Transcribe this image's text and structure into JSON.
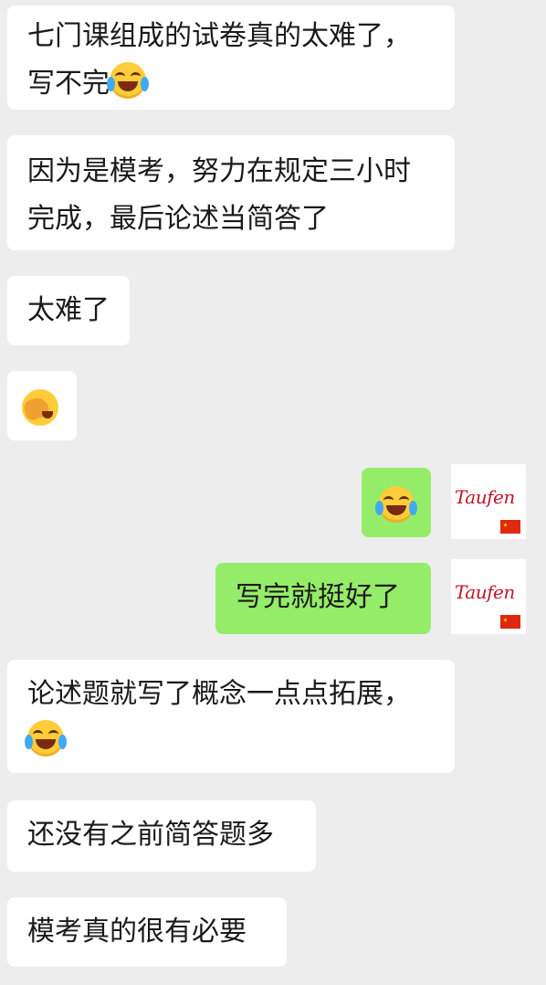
{
  "messages": {
    "m1": {
      "line1": "七门课组成的试卷真的太难了，",
      "line2": "写不完"
    },
    "m2": {
      "line1": "因为是模考，努力在规定三小时",
      "line2": "完成，最后论述当简答了"
    },
    "m3": {
      "text": "太难了"
    },
    "m5": {
      "text": "写完就挺好了"
    },
    "m6": {
      "line1": "论述题就写了概念一点点拓展，"
    },
    "m7": {
      "text": "还没有之前简答题多"
    },
    "m8": {
      "text": "模考真的很有必要"
    }
  },
  "avatar": {
    "name": "Taufen"
  },
  "emoji": {
    "tears_of_joy": "tears-of-joy-icon",
    "facepalm": "facepalm-icon"
  },
  "colors": {
    "background": "#ededed",
    "incoming_bubble": "#ffffff",
    "outgoing_bubble": "#95ec69"
  }
}
